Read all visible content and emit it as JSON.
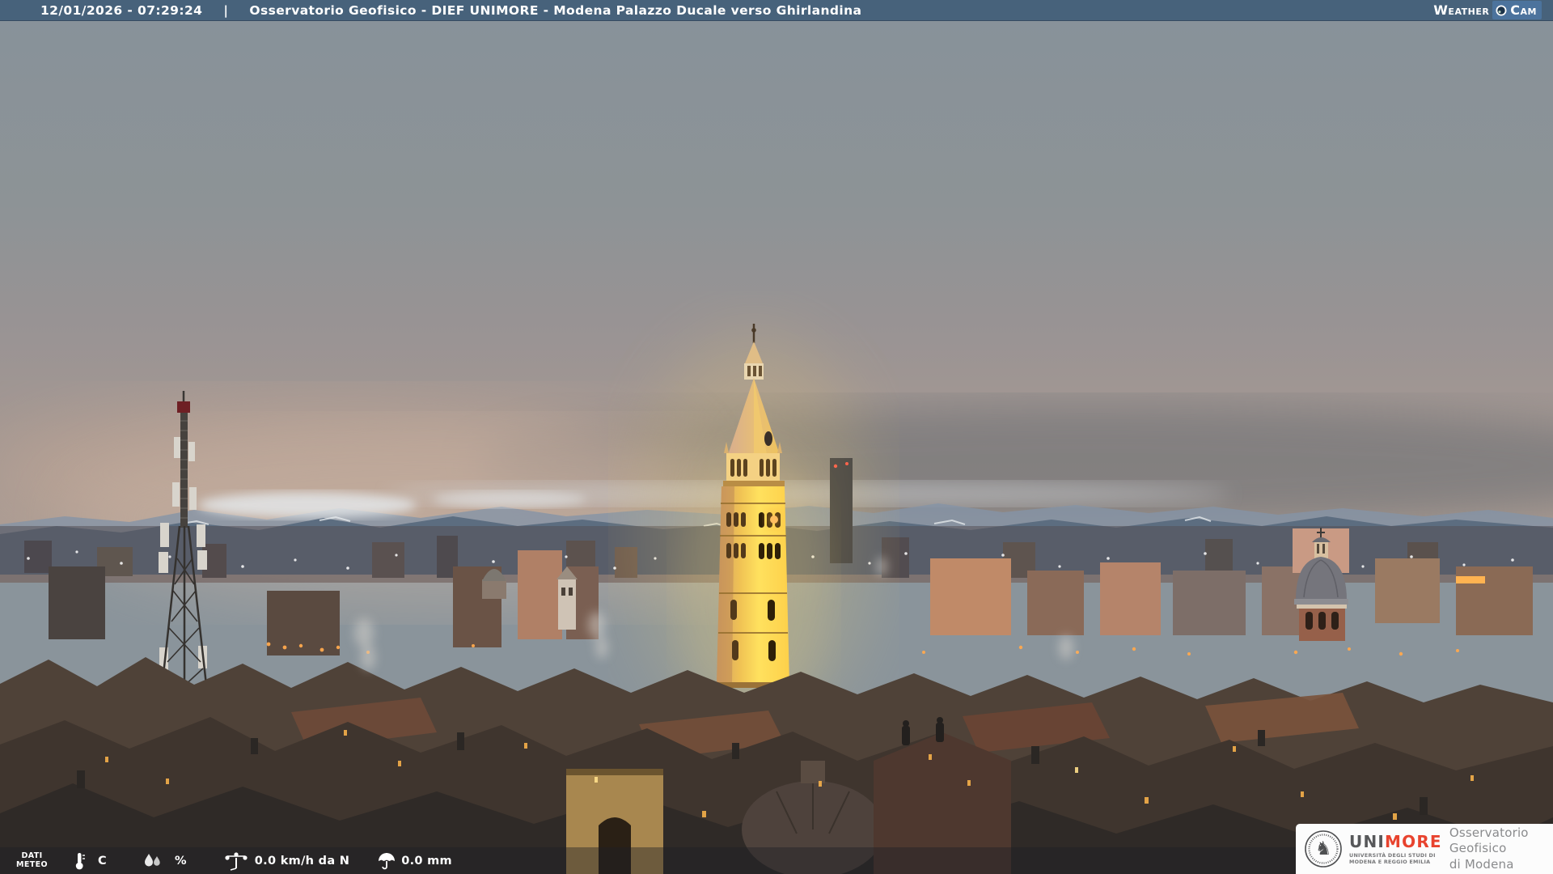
{
  "header": {
    "timestamp": "12/01/2026 - 07:29:24",
    "separator": "|",
    "title": "Osservatorio Geofisico - DIEF UNIMORE - Modena Palazzo Ducale verso Ghirlandina",
    "brand": {
      "weather": "Weather",
      "cam": "Cam"
    }
  },
  "weather_bar": {
    "label_line1": "DATI",
    "label_line2": "METEO",
    "temperature_value": "",
    "temperature_unit": "C",
    "humidity_value": "",
    "humidity_unit": "%",
    "wind_value": "0.0 km/h da N",
    "rain_value": "0.0 mm"
  },
  "logo_card": {
    "brand_uni": "UNI",
    "brand_more": "MORE",
    "university_line1": "UNIVERSITÀ DEGLI STUDI DI",
    "university_line2": "MODENA E REGGIO EMILIA",
    "org_line1": "Osservatorio Geofisico",
    "org_line2": "di Modena"
  },
  "icons": {
    "temperature": "thermometer-icon",
    "humidity": "water-drops-icon",
    "wind": "anemometer-icon",
    "rain": "umbrella-icon",
    "webcam_brand": "camera-lens-icon",
    "university_seal": "knight-on-horseback-seal"
  },
  "colors": {
    "header_bg": "#47627b",
    "cam_badge_bg": "#4c739d",
    "unimore_red": "#e8432e",
    "tower_light": "#ffd84e",
    "sky_top": "#87929a",
    "sky_horizon": "#ab9c93",
    "mountains": "#5c6d80"
  }
}
